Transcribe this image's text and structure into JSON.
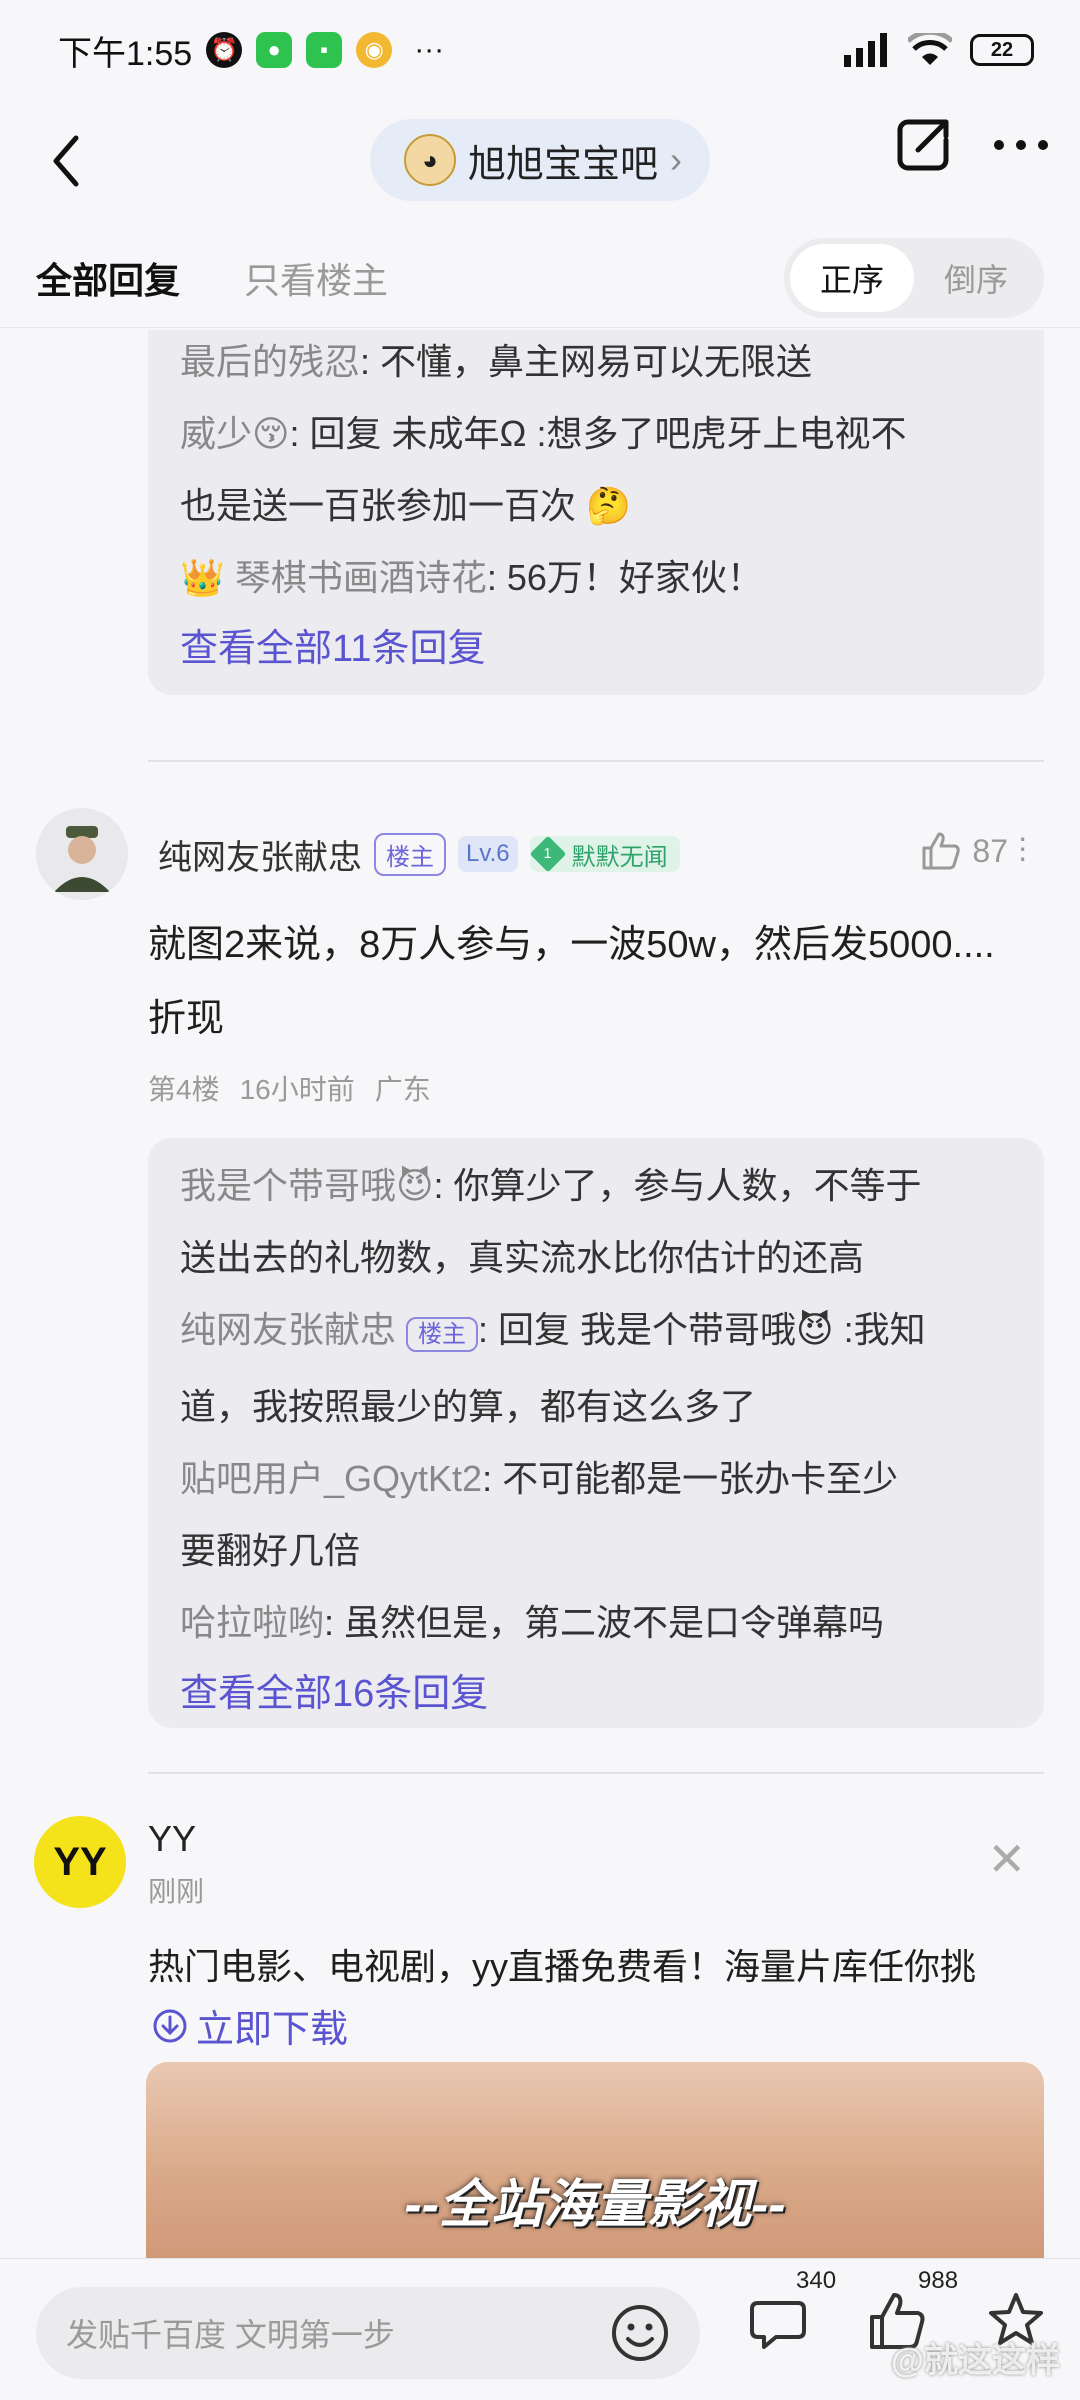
{
  "status_bar": {
    "time": "下午1:55",
    "more": "···",
    "battery": "22"
  },
  "nav": {
    "forum_name": "旭旭宝宝吧",
    "forum_chevron": "›"
  },
  "tabs": {
    "all": "全部回复",
    "host_only": "只看楼主",
    "asc": "正序",
    "desc": "倒序"
  },
  "prev_replies": {
    "lines": [
      {
        "name": "最后的残忍",
        "text": ": 不懂，鼻主网易可以无限送"
      },
      {
        "name": "威少😚",
        "text": ": 回复 未成年Ω :想多了吧虎牙上电视不"
      },
      {
        "name": "",
        "text": "也是送一百张参加一百次 🤔"
      },
      {
        "name": "👑 琴棋书画酒诗花",
        "text": ": 56万！好家伙！"
      }
    ],
    "more": "查看全部11条回复"
  },
  "post": {
    "username": "纯网友张献忠",
    "host_badge": "楼主",
    "level": "Lv.6",
    "fan_level": "1",
    "fan_title": "默默无闻",
    "likes": "87",
    "text_line1": "就图2来说，8万人参与，一波50w，然后发5000....",
    "text_line2": "折现",
    "floor": "第4楼",
    "time": "16小时前",
    "location": "广东"
  },
  "post_replies": {
    "lines": [
      {
        "name": "我是个带哥哦😈",
        "text": ": 你算少了，参与人数，不等于"
      },
      {
        "name": "",
        "text": "送出去的礼物数，真实流水比你估计的还高"
      },
      {
        "name": "纯网友张献忠",
        "badge": "楼主",
        "text": ": 回复 我是个带哥哦😈 :我知"
      },
      {
        "name": "",
        "text": "道，我按照最少的算，都有这么多了"
      },
      {
        "name": "贴吧用户_GQytKt2",
        "text": ": 不可能都是一张办卡至少"
      },
      {
        "name": "",
        "text": "要翻好几倍"
      },
      {
        "name": "哈拉啦哟",
        "text": ": 虽然但是，第二波不是口令弹幕吗"
      }
    ],
    "more": "查看全部16条回复"
  },
  "ad": {
    "logo": "YY",
    "name": "YY",
    "time": "刚刚",
    "text": "热门电影、电视剧，yy直播免费看！海量片库任你挑",
    "download": "立即下载",
    "caption": "--全站海量影视--"
  },
  "bottom": {
    "placeholder": "发贴千百度 文明第一步",
    "comments": "340",
    "likes": "988",
    "watermark": "@就这这样"
  }
}
